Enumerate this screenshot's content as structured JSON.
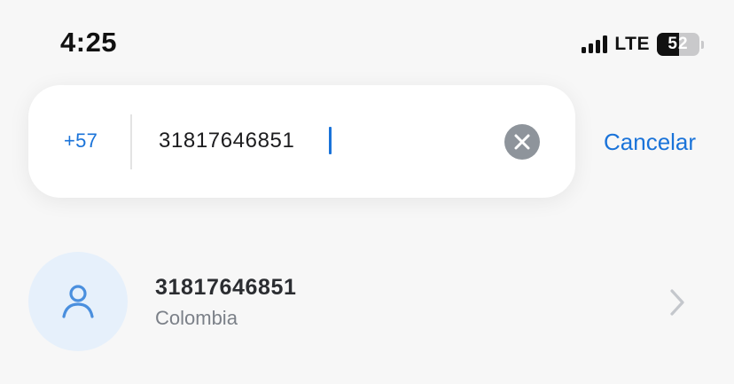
{
  "status_bar": {
    "time": "4:25",
    "network": "LTE",
    "battery_level": "52",
    "battery_fraction": 0.52,
    "signal_bars": 4
  },
  "search": {
    "country_code": "+57",
    "value": "31817646851",
    "clear_icon": "close-circle-icon",
    "cancel_label": "Cancelar"
  },
  "results": [
    {
      "number": "31817646851",
      "country": "Colombia",
      "icon": "person-icon"
    }
  ],
  "colors": {
    "accent": "#1a73d9",
    "avatar_bg": "#e6f0fb",
    "clear_button": "#8e949b",
    "background": "#f7f7f7"
  }
}
